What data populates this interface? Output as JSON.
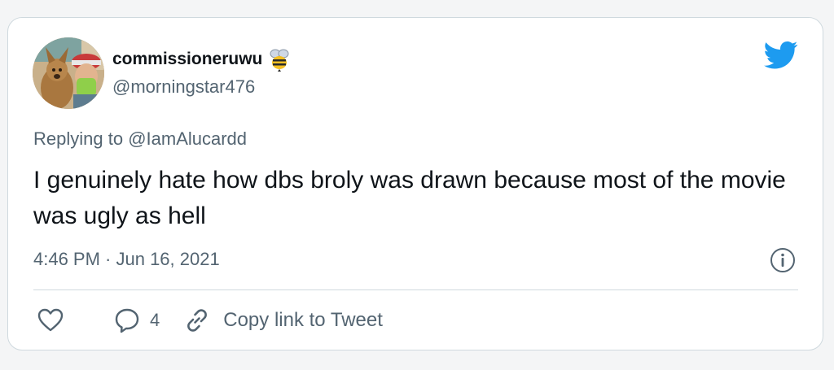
{
  "tweet": {
    "author": {
      "display_name": "commissioneruwu",
      "name_emoji": "bee-icon",
      "handle": "@morningstar476"
    },
    "replying_to_prefix": "Replying to ",
    "replying_to_handle": "@IamAlucardd",
    "text": "I genuinely hate how dbs broly was drawn because most of the movie was ugly as hell",
    "timestamp": "4:46 PM · Jun 16, 2021"
  },
  "actions": {
    "like_icon": "heart-icon",
    "reply_icon": "speech-bubble-icon",
    "reply_count": "4",
    "copy_link_icon": "link-icon",
    "copy_link_label": "Copy link to Tweet"
  },
  "icons": {
    "brand": "twitter-bird-icon",
    "info": "info-icon"
  },
  "colors": {
    "twitter_blue": "#1d9bf0",
    "text_primary": "#0f1419",
    "text_secondary": "#536471",
    "border": "#cfd9de"
  }
}
